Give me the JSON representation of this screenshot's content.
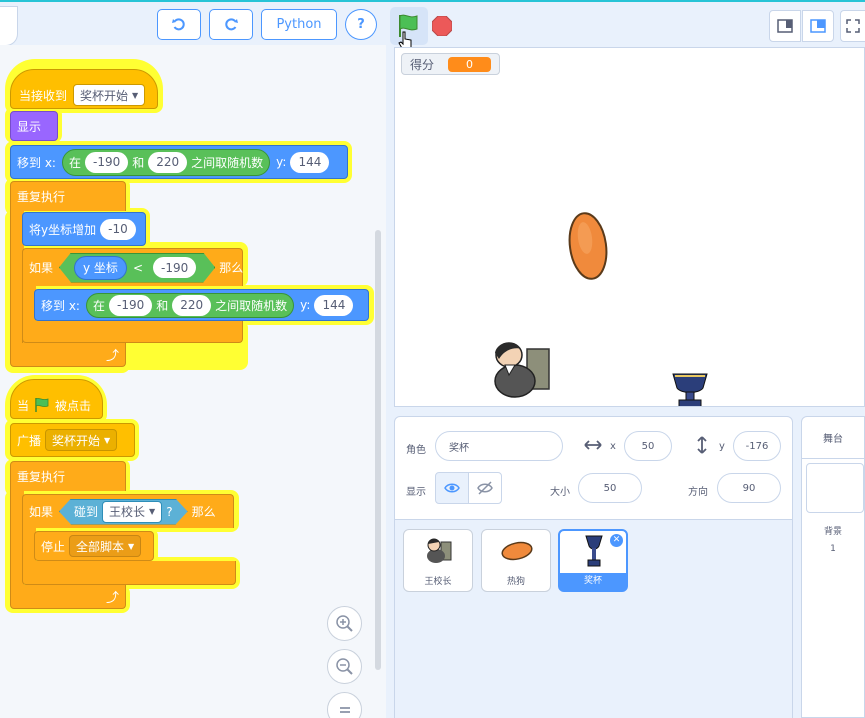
{
  "toolbar": {
    "python_label": "Python",
    "help_label": "?"
  },
  "blocks": {
    "script1": {
      "hat_prefix": "当接收到",
      "hat_message": "奖杯开始",
      "show": "显示",
      "goto_prefix": "移到 x:",
      "rand_in": "在",
      "rand_min": "-190",
      "rand_and": "和",
      "rand_max": "220",
      "rand_suffix": "之间取随机数",
      "goto_y_label": "y:",
      "goto_y": "144",
      "forever": "重复执行",
      "change_y": "将y坐标增加",
      "change_y_val": "-10",
      "if_label": "如果",
      "y_reporter": "y 坐标",
      "lt": "<",
      "compare_val": "-190",
      "then": "那么",
      "inner_goto_prefix": "移到 x:",
      "inner_rand_in": "在",
      "inner_rand_min": "-190",
      "inner_rand_and": "和",
      "inner_rand_max": "220",
      "inner_rand_suffix": "之间取随机数",
      "inner_y_label": "y:",
      "inner_y": "144"
    },
    "script2": {
      "when": "当",
      "clicked": "被点击",
      "broadcast": "广播",
      "broadcast_msg": "奖杯开始",
      "forever": "重复执行",
      "if_label": "如果",
      "touching": "碰到",
      "touch_target": "王校长",
      "q": "?",
      "then": "那么",
      "stop": "停止",
      "stop_option": "全部脚本"
    }
  },
  "stage": {
    "score_label": "得分",
    "score_value": "0"
  },
  "sprite_info": {
    "sprite_label": "角色",
    "sprite_name": "奖杯",
    "x_label": "x",
    "x_value": "50",
    "y_label": "y",
    "y_value": "-176",
    "show_label": "显示",
    "size_label": "大小",
    "size_value": "50",
    "direction_label": "方向",
    "direction_value": "90"
  },
  "sprites": [
    {
      "name": "王校长"
    },
    {
      "name": "热狗"
    },
    {
      "name": "奖杯"
    }
  ],
  "stage_panel": {
    "title": "舞台",
    "backdrop_label": "背景",
    "backdrop_count": "1"
  },
  "colors": {
    "accent": "#4c97ff",
    "events": "#ffbf00",
    "control": "#ffab19",
    "motion": "#4c97ff",
    "looks": "#9966ff",
    "operators": "#59c059",
    "sensing": "#5cb1d6",
    "highlight": "#ffff33"
  }
}
